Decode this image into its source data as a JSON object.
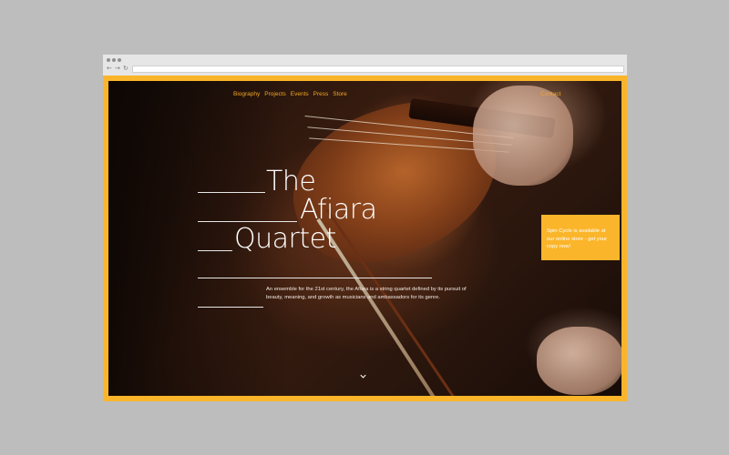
{
  "nav": {
    "items": [
      "Biography",
      "Projects",
      "Events",
      "Press",
      "Store"
    ],
    "contact": "Contact"
  },
  "hero": {
    "title_line_1": "The",
    "title_line_2": "Afiara",
    "title_line_3": "Quartet",
    "description": "An ensemble for the 21st century, the Afiara is a string quartet defined by its pursuit of beauty, meaning, and growth as musicians and ambassadors for its genre."
  },
  "promo": {
    "text_before": "Spin Cycle is available at our ",
    "link_text": "online store",
    "text_after": " - get your copy now!"
  },
  "icons": {
    "scroll_down": "chevron-down-icon",
    "back": "arrow-left-icon",
    "forward": "arrow-right-icon",
    "reload": "reload-icon"
  },
  "colors": {
    "accent": "#fbb52a",
    "nav_text": "#f4a624",
    "title_text": "#ffffff"
  }
}
